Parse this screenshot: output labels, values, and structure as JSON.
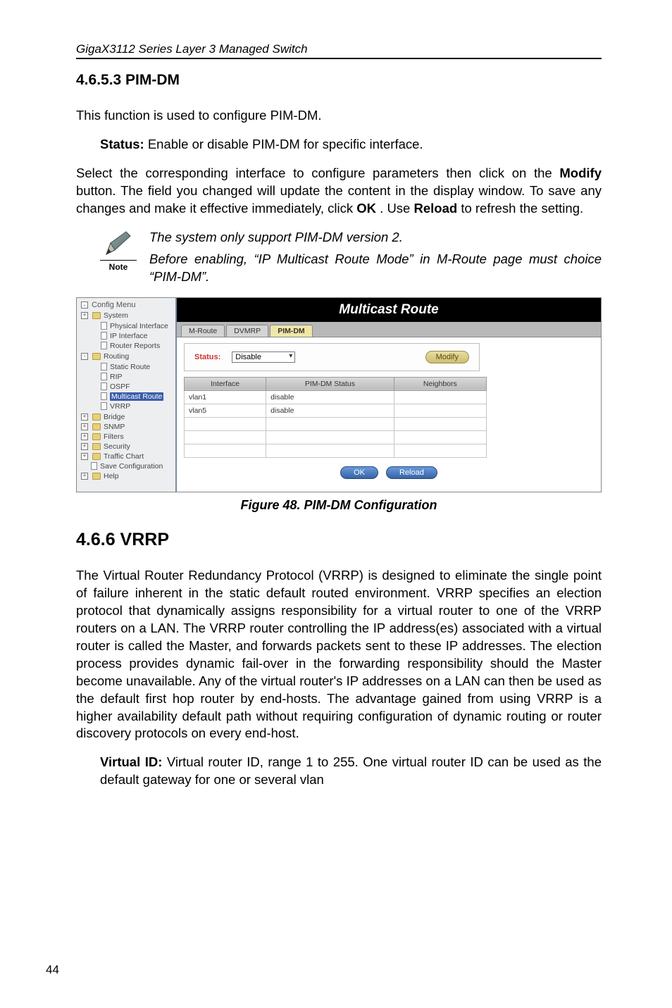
{
  "header": "GigaX3112 Series Layer 3 Managed Switch",
  "sec1": {
    "heading": "4.6.5.3  PIM-DM",
    "p1": "This function is used to configure PIM-DM.",
    "status_label": "Status:",
    "status_desc": " Enable or disable PIM-DM for specific interface.",
    "p3_a": "Select the corresponding interface to configure parameters then click on the ",
    "p3_modify": "Modify",
    "p3_b": " button. The field you changed will update the content in the display window. To save any changes and make it effective immediately, click ",
    "p3_ok": "OK",
    "p3_c": ". Use ",
    "p3_reload": "Reload",
    "p3_d": " to refresh the setting."
  },
  "note": {
    "caption": "Note",
    "line1": "The system only support PIM-DM version 2.",
    "line2": "Before enabling, “IP Multicast Route Mode” in M-Route page must choice “PIM-DM”."
  },
  "figure": {
    "tree": {
      "title": "Config Menu",
      "items": [
        "System",
        "Physical Interface",
        "IP Interface",
        "Router Reports",
        "Routing",
        "Static Route",
        "RIP",
        "OSPF",
        "Multicast Route",
        "VRRP",
        "Bridge",
        "SNMP",
        "Filters",
        "Security",
        "Traffic Chart",
        "Save Configuration",
        "Help"
      ]
    },
    "panel_title": "Multicast Route",
    "tabs": [
      "M-Route",
      "DVMRP",
      "PIM-DM"
    ],
    "status_label": "Status:",
    "status_value": "Disable",
    "modify_btn": "Modify",
    "table": {
      "headers": [
        "Interface",
        "PIM-DM Status",
        "Neighbors"
      ],
      "rows": [
        [
          "vlan1",
          "disable",
          ""
        ],
        [
          "vlan5",
          "disable",
          ""
        ]
      ]
    },
    "ok_btn": "OK",
    "reload_btn": "Reload",
    "caption": "Figure 48. PIM-DM Configuration"
  },
  "sec2": {
    "heading": "4.6.6    VRRP",
    "p1": "The Virtual Router Redundancy Protocol (VRRP) is designed to eliminate the single point of failure inherent in the static default routed environment. VRRP specifies an election protocol that dynamically assigns responsibility for a virtual router to one of the VRRP routers on a LAN. The VRRP router controlling the IP address(es) associated with a virtual router is called the Master, and forwards packets sent to these IP addresses. The election process provides dynamic fail-over in the forwarding responsibility should the Master become unavailable. Any of the virtual router's IP   addresses on a LAN can then be used as the default first hop router by end-hosts.  The advantage gained from using VRRP is a higher availability default path without requiring configuration of dynamic routing or router discovery protocols on every end-host.",
    "vid_label": "Virtual ID:",
    "vid_desc": " Virtual router ID, range 1 to 255. One virtual router ID can be used as the default gateway for one or several vlan"
  },
  "page_number": "44"
}
